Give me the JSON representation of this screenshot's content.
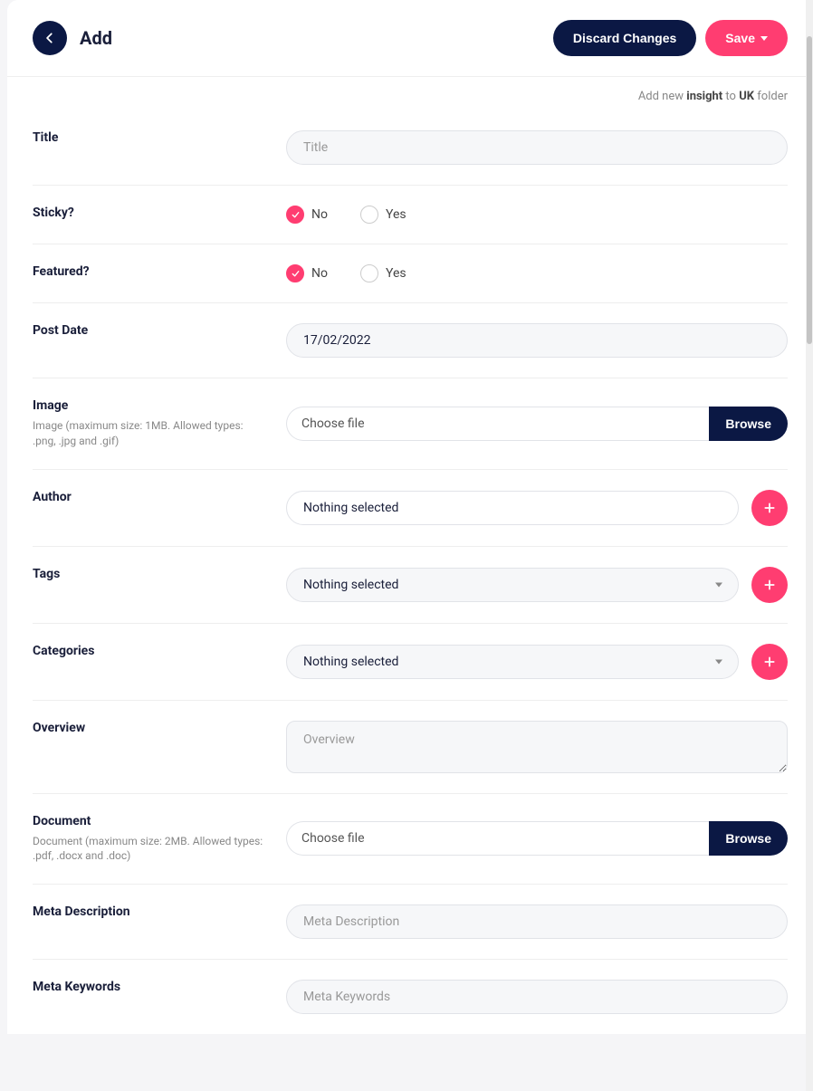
{
  "header": {
    "title": "Add",
    "discard_label": "Discard Changes",
    "save_label": "Save"
  },
  "breadcrumb": {
    "prefix": "Add new ",
    "entity": "insight",
    "mid": " to ",
    "folder": "UK",
    "suffix": " folder"
  },
  "fields": {
    "title": {
      "label": "Title",
      "placeholder": "Title",
      "value": ""
    },
    "sticky": {
      "label": "Sticky?",
      "options": [
        "No",
        "Yes"
      ],
      "selected": "No"
    },
    "featured": {
      "label": "Featured?",
      "options": [
        "No",
        "Yes"
      ],
      "selected": "No"
    },
    "post_date": {
      "label": "Post Date",
      "value": "17/02/2022"
    },
    "image": {
      "label": "Image",
      "hint": "Image (maximum size: 1MB. Allowed types: .png, .jpg and .gif)",
      "display": "Choose file",
      "browse": "Browse"
    },
    "author": {
      "label": "Author",
      "selected": "Nothing selected"
    },
    "tags": {
      "label": "Tags",
      "selected": "Nothing selected"
    },
    "categories": {
      "label": "Categories",
      "selected": "Nothing selected"
    },
    "overview": {
      "label": "Overview",
      "placeholder": "Overview",
      "value": ""
    },
    "document": {
      "label": "Document",
      "hint": "Document (maximum size: 2MB. Allowed types: .pdf, .docx and .doc)",
      "display": "Choose file",
      "browse": "Browse"
    },
    "meta_description": {
      "label": "Meta Description",
      "placeholder": "Meta Description",
      "value": ""
    },
    "meta_keywords": {
      "label": "Meta Keywords",
      "placeholder": "Meta Keywords",
      "value": ""
    }
  }
}
